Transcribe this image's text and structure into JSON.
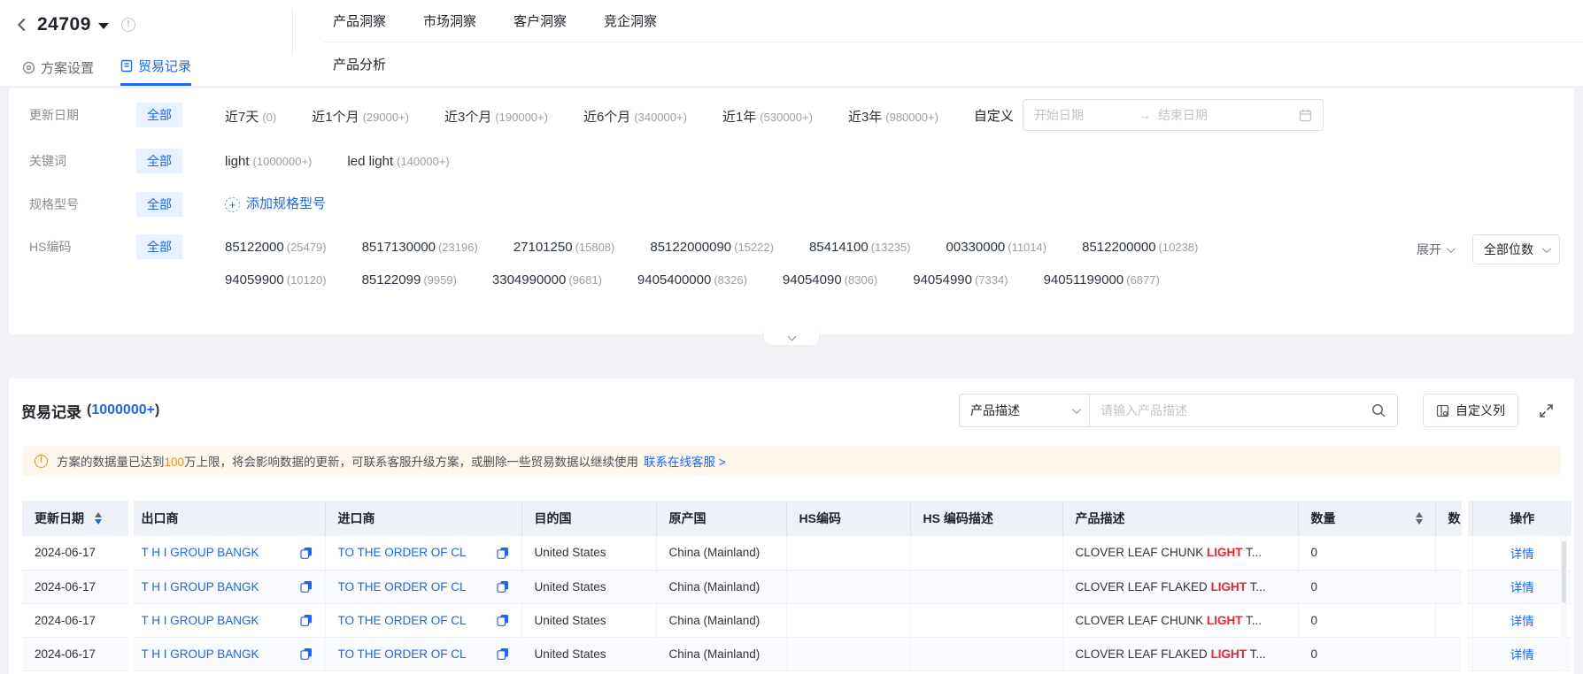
{
  "colors": {
    "accent": "#1a66ff",
    "keyword_highlight": "#f5222d",
    "warning": "#fa8c16"
  },
  "header": {
    "plan_id": "24709",
    "insight_tabs": [
      {
        "label": "产品洞察"
      },
      {
        "label": "市场洞察"
      },
      {
        "label": "客户洞察"
      },
      {
        "label": "竞企洞察"
      }
    ],
    "sub_tab": "产品分析",
    "plan_tabs": {
      "settings": "方案设置",
      "trade_records": "贸易记录"
    }
  },
  "filters": {
    "all_label": "全部",
    "update_date": {
      "label": "更新日期",
      "options": [
        {
          "name": "近7天",
          "count": "(0)"
        },
        {
          "name": "近1个月",
          "count": "(29000+)"
        },
        {
          "name": "近3个月",
          "count": "(190000+)"
        },
        {
          "name": "近6个月",
          "count": "(340000+)"
        },
        {
          "name": "近1年",
          "count": "(530000+)"
        },
        {
          "name": "近3年",
          "count": "(980000+)"
        }
      ],
      "custom_label": "自定义",
      "start_placeholder": "开始日期",
      "end_placeholder": "结束日期",
      "range_arrow": "→"
    },
    "keyword": {
      "label": "关键词",
      "options": [
        {
          "name": "light",
          "count": "(1000000+)"
        },
        {
          "name": "led light",
          "count": "(140000+)"
        }
      ]
    },
    "spec": {
      "label": "规格型号",
      "add_label": "添加规格型号",
      "plus": "+"
    },
    "hs": {
      "label": "HS编码",
      "line1": [
        {
          "code": "85122000",
          "count": "(25479)"
        },
        {
          "code": "8517130000",
          "count": "(23196)"
        },
        {
          "code": "27101250",
          "count": "(15808)"
        },
        {
          "code": "85122000090",
          "count": "(15222)"
        },
        {
          "code": "85414100",
          "count": "(13235)"
        },
        {
          "code": "00330000",
          "count": "(11014)"
        },
        {
          "code": "8512200000",
          "count": "(10238)"
        }
      ],
      "line2": [
        {
          "code": "94059900",
          "count": "(10120)"
        },
        {
          "code": "85122099",
          "count": "(9959)"
        },
        {
          "code": "3304990000",
          "count": "(9681)"
        },
        {
          "code": "9405400000",
          "count": "(8326)"
        },
        {
          "code": "94054090",
          "count": "(8306)"
        },
        {
          "code": "94054990",
          "count": "(7334)"
        },
        {
          "code": "94051199000",
          "count": "(6877)"
        }
      ],
      "expand_label": "展开",
      "digits_label": "全部位数"
    }
  },
  "records": {
    "title": "贸易记录",
    "count_paren_open": "(",
    "count": "1000000+",
    "count_paren_close": ")",
    "search_field_label": "产品描述",
    "search_placeholder": "请输入产品描述",
    "custom_columns_label": "自定义列",
    "banner": {
      "icon": "!",
      "pre": "方案的数据量已达到",
      "highlight": "100",
      "post": "万上限，将会影响数据的更新，可联系客服升级方案，或删除一些贸易数据以继续使用",
      "link": "联系在线客服 >"
    }
  },
  "table": {
    "headers": [
      "更新日期",
      "出口商",
      "进口商",
      "目的国",
      "原产国",
      "HS编码",
      "HS 编码描述",
      "产品描述",
      "数量",
      "数",
      "操作"
    ],
    "rows": [
      {
        "date": "2024-06-17",
        "exporter": "T H I GROUP BANGK",
        "importer": "TO THE ORDER OF CL",
        "dest": "United States",
        "origin": "China (Mainland)",
        "hs_code": "",
        "hs_desc": "",
        "desc_pre": "CLOVER LEAF CHUNK ",
        "desc_hl": "LIGHT",
        "desc_suf": " T...",
        "qty": "0",
        "qty2": "",
        "action": "详情"
      },
      {
        "date": "2024-06-17",
        "exporter": "T H I GROUP BANGK",
        "importer": "TO THE ORDER OF CL",
        "dest": "United States",
        "origin": "China (Mainland)",
        "hs_code": "",
        "hs_desc": "",
        "desc_pre": "CLOVER LEAF FLAKED ",
        "desc_hl": "LIGHT",
        "desc_suf": " T...",
        "qty": "0",
        "qty2": "",
        "action": "详情"
      },
      {
        "date": "2024-06-17",
        "exporter": "T H I GROUP BANGK",
        "importer": "TO THE ORDER OF CL",
        "dest": "United States",
        "origin": "China (Mainland)",
        "hs_code": "",
        "hs_desc": "",
        "desc_pre": "CLOVER LEAF CHUNK ",
        "desc_hl": "LIGHT",
        "desc_suf": " T...",
        "qty": "0",
        "qty2": "",
        "action": "详情"
      },
      {
        "date": "2024-06-17",
        "exporter": "T H I GROUP BANGK",
        "importer": "TO THE ORDER OF CL",
        "dest": "United States",
        "origin": "China (Mainland)",
        "hs_code": "",
        "hs_desc": "",
        "desc_pre": "CLOVER LEAF FLAKED ",
        "desc_hl": "LIGHT",
        "desc_suf": " T...",
        "qty": "0",
        "qty2": "",
        "action": "详情"
      }
    ]
  }
}
